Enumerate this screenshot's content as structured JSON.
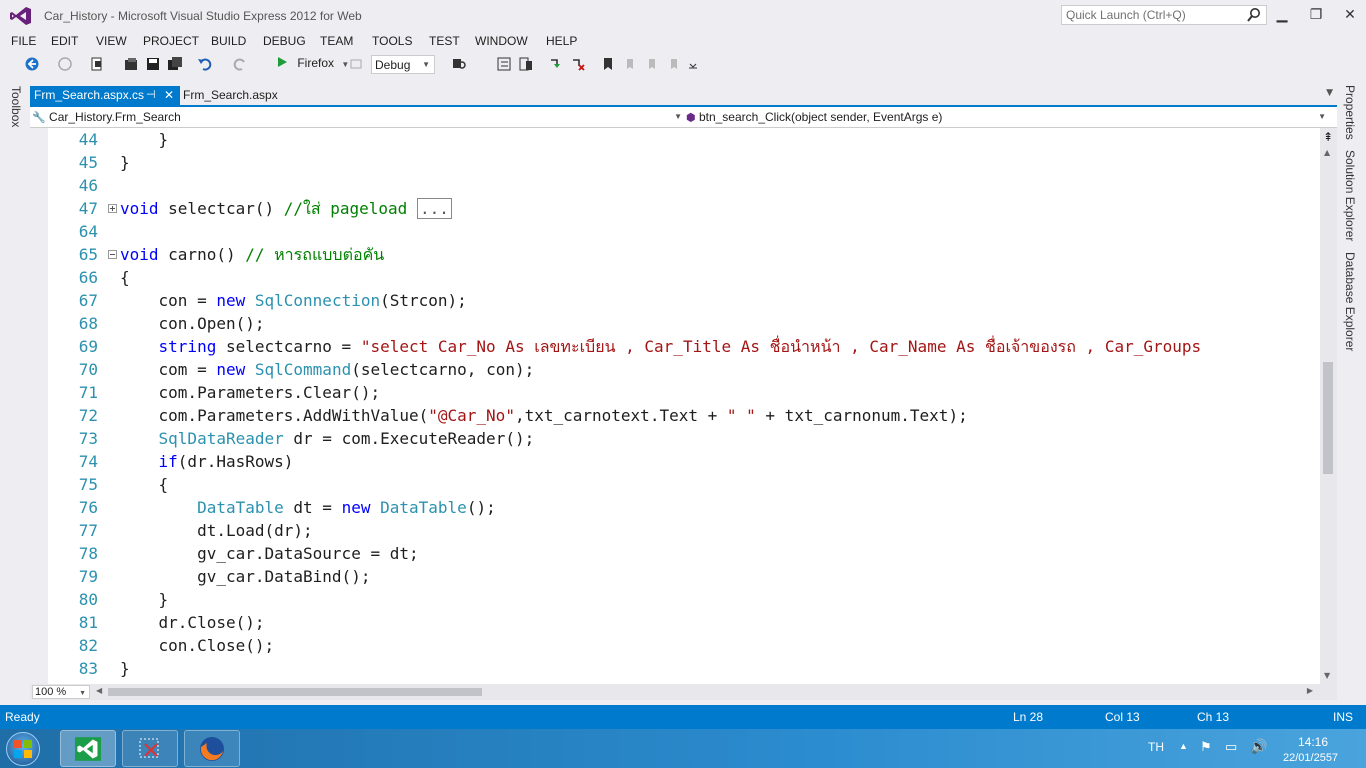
{
  "window": {
    "title": "Car_History - Microsoft Visual Studio Express 2012 for Web",
    "quick_launch_placeholder": "Quick Launch (Ctrl+Q)",
    "minimize": "▁",
    "restore": "❐",
    "close": "✕"
  },
  "menu": [
    "FILE",
    "EDIT",
    "VIEW",
    "PROJECT",
    "BUILD",
    "DEBUG",
    "TEAM",
    "TOOLS",
    "TEST",
    "WINDOW",
    "HELP"
  ],
  "toolbar": {
    "run_label": "Firefox",
    "config": "Debug"
  },
  "side_panels": {
    "toolbox": "Toolbox",
    "properties": "Properties",
    "solution_explorer": "Solution Explorer",
    "database_explorer": "Database Explorer"
  },
  "tabs": [
    {
      "label": "Frm_Search.aspx.cs",
      "active": true
    },
    {
      "label": "Frm_Search.aspx",
      "active": false
    }
  ],
  "navigation": {
    "class_dropdown": "Car_History.Frm_Search",
    "member_dropdown": "btn_search_Click(object sender, EventArgs e)"
  },
  "editor": {
    "lines": [
      {
        "n": "44",
        "code": "            }"
      },
      {
        "n": "45",
        "code": "        }"
      },
      {
        "n": "46",
        "code": ""
      },
      {
        "n": "47",
        "code": "        void selectcar() //ใส่ pageload ..."
      },
      {
        "n": "64",
        "code": ""
      },
      {
        "n": "65",
        "code": "        void carno() // หารถแบบต่อคัน"
      },
      {
        "n": "66",
        "code": "        {"
      },
      {
        "n": "67",
        "code": "            con = new SqlConnection(Strcon);"
      },
      {
        "n": "68",
        "code": "            con.Open();"
      },
      {
        "n": "69",
        "code": "            string selectcarno = \"select Car_No As เลขทะเบียน , Car_Title As ชื่อนำหน้า , Car_Name As ชื่อเจ้าของรถ , Car_Groups"
      },
      {
        "n": "70",
        "code": "            com = new SqlCommand(selectcarno, con);"
      },
      {
        "n": "71",
        "code": "            com.Parameters.Clear();"
      },
      {
        "n": "72",
        "code": "            com.Parameters.AddWithValue(\"@Car_No\",txt_carnotext.Text + \" \" + txt_carnonum.Text);"
      },
      {
        "n": "73",
        "code": "            SqlDataReader dr = com.ExecuteReader();"
      },
      {
        "n": "74",
        "code": "            if(dr.HasRows)"
      },
      {
        "n": "75",
        "code": "            {"
      },
      {
        "n": "76",
        "code": "                DataTable dt = new DataTable();"
      },
      {
        "n": "77",
        "code": "                dt.Load(dr);"
      },
      {
        "n": "78",
        "code": "                gv_car.DataSource = dt;"
      },
      {
        "n": "79",
        "code": "                gv_car.DataBind();"
      },
      {
        "n": "80",
        "code": "            }"
      },
      {
        "n": "81",
        "code": "            dr.Close();"
      },
      {
        "n": "82",
        "code": "            con.Close();"
      },
      {
        "n": "83",
        "code": "        }"
      }
    ],
    "zoom": "100 %"
  },
  "status": {
    "state": "Ready",
    "line": "Ln 28",
    "col": "Col 13",
    "ch": "Ch 13",
    "mode": "INS"
  },
  "taskbar": {
    "language": "TH",
    "time": "14:16",
    "date": "22/01/2557"
  },
  "colors": {
    "accent": "#007acc",
    "keyword": "#0000ff",
    "type": "#2b91af",
    "string": "#a31515",
    "comment": "#008000"
  }
}
